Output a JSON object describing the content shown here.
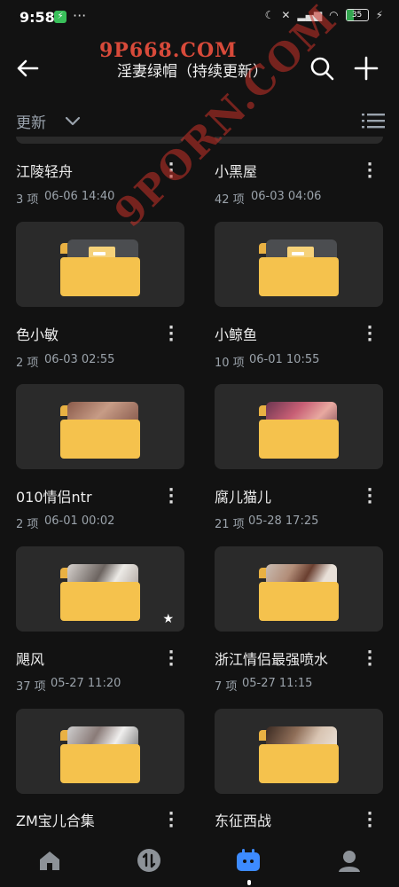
{
  "status": {
    "time": "9:58",
    "battery": "35"
  },
  "watermarks": {
    "top": "9P668.COM",
    "diagonal": "9PORN.COM"
  },
  "appbar": {
    "title": "淫妻绿帽（持续更新）"
  },
  "sort": {
    "label": "更新"
  },
  "folders": [
    {
      "name": "江陵轻舟",
      "count": "3 项",
      "date": "06-06 14:40"
    },
    {
      "name": "小黑屋",
      "count": "42 项",
      "date": "06-03 04:06"
    },
    {
      "name": "色小敏",
      "count": "2 项",
      "date": "06-03 02:55"
    },
    {
      "name": "小鲸鱼",
      "count": "10 项",
      "date": "06-01 10:55"
    },
    {
      "name": "010情侣ntr",
      "count": "2 项",
      "date": "06-01 00:02"
    },
    {
      "name": "腐儿猫儿",
      "count": "21 项",
      "date": "05-28 17:25"
    },
    {
      "name": "飓风",
      "count": "37 项",
      "date": "05-27 11:20"
    },
    {
      "name": "浙江情侣最强喷水",
      "count": "7 项",
      "date": "05-27 11:15"
    },
    {
      "name": "ZM宝儿合集",
      "count": "",
      "date": ""
    },
    {
      "name": "东征西战",
      "count": "",
      "date": ""
    }
  ]
}
